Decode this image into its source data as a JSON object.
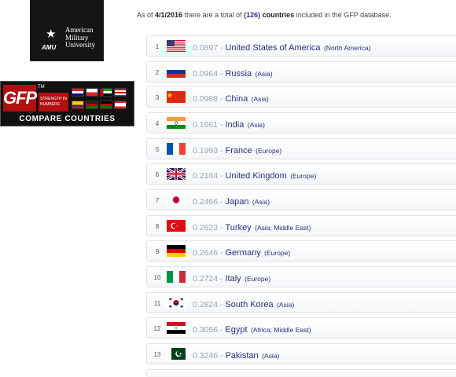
{
  "ads": {
    "amu": {
      "name_line1": "American",
      "name_line2": "Military",
      "name_line3": "University",
      "acronym": "AMU",
      "icon": "star-icon"
    },
    "gfp": {
      "logo": "GFP",
      "tm": "TM",
      "tagline_line1": "STRENGTH IN",
      "tagline_line2": "NUMBERS",
      "banner": "COMPARE COUNTRIES"
    }
  },
  "summary": {
    "prefix": "As of",
    "date": "4/1/2016",
    "middle": "there are a total of",
    "count": "(126)",
    "countries_word": "countries",
    "suffix": "included in the GFP database."
  },
  "rows": [
    {
      "rank": "1",
      "score": "0.0897",
      "country": "United States of America",
      "region": "(North America)",
      "flag": "flag-usa-icon"
    },
    {
      "rank": "2",
      "score": "0.0964",
      "country": "Russia",
      "region": "(Asia)",
      "flag": "flag-russia-icon"
    },
    {
      "rank": "3",
      "score": "0.0988",
      "country": "China",
      "region": "(Asia)",
      "flag": "flag-china-icon"
    },
    {
      "rank": "4",
      "score": "0.1661",
      "country": "India",
      "region": "(Asia)",
      "flag": "flag-india-icon"
    },
    {
      "rank": "5",
      "score": "0.1993",
      "country": "France",
      "region": "(Europe)",
      "flag": "flag-france-icon"
    },
    {
      "rank": "6",
      "score": "0.2164",
      "country": "United Kingdom",
      "region": "(Europe)",
      "flag": "flag-uk-icon"
    },
    {
      "rank": "7",
      "score": "0.2466",
      "country": "Japan",
      "region": "(Asia)",
      "flag": "flag-japan-icon"
    },
    {
      "rank": "8",
      "score": "0.2623",
      "country": "Turkey",
      "region": "(Asia; Middle East)",
      "flag": "flag-turkey-icon"
    },
    {
      "rank": "9",
      "score": "0.2646",
      "country": "Germany",
      "region": "(Europe)",
      "flag": "flag-germany-icon"
    },
    {
      "rank": "10",
      "score": "0.2724",
      "country": "Italy",
      "region": "(Europe)",
      "flag": "flag-italy-icon"
    },
    {
      "rank": "11",
      "score": "0.2824",
      "country": "South Korea",
      "region": "(Asia)",
      "flag": "flag-south-korea-icon"
    },
    {
      "rank": "12",
      "score": "0.3056",
      "country": "Egypt",
      "region": "(Africa; Middle East)",
      "flag": "flag-egypt-icon"
    },
    {
      "rank": "13",
      "score": "0.3246",
      "country": "Pakistan",
      "region": "(Asia)",
      "flag": "flag-pakistan-icon"
    }
  ],
  "colors": {
    "link": "#2a2f7f",
    "score": "#9aa6b8",
    "gfp_red": "#b01010"
  }
}
